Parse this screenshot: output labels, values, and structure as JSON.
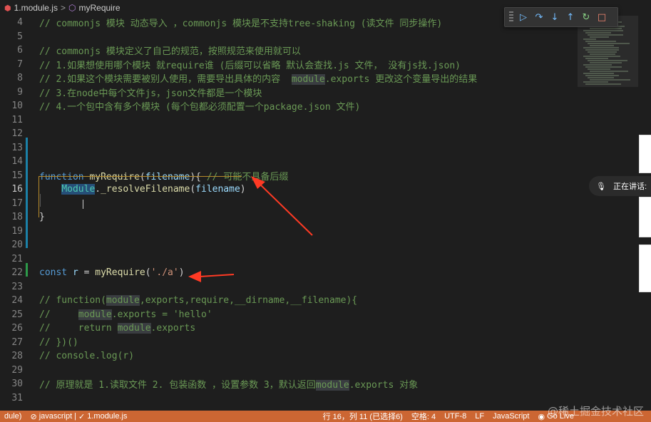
{
  "breadcrumb": {
    "file": "1.module.js",
    "separator": ">",
    "symbol": "myRequire"
  },
  "debug_toolbar": {
    "buttons": [
      {
        "name": "continue-icon",
        "glyph": "▷",
        "color": "#75beff"
      },
      {
        "name": "step-over-icon",
        "glyph": "↷",
        "color": "#75beff"
      },
      {
        "name": "step-into-icon",
        "glyph": "↓",
        "color": "#75beff"
      },
      {
        "name": "step-out-icon",
        "glyph": "↑",
        "color": "#75beff"
      },
      {
        "name": "restart-icon",
        "glyph": "↻",
        "color": "#89d185"
      },
      {
        "name": "stop-icon",
        "glyph": "□",
        "color": "#f48771"
      }
    ]
  },
  "lines": [
    {
      "n": "4",
      "tokens": [
        {
          "t": "// commonjs 模块 动态导入 ，commonjs 模块是不支持tree-shaking (读文件 同步操作)",
          "c": "comment"
        }
      ]
    },
    {
      "n": "5",
      "tokens": []
    },
    {
      "n": "6",
      "tokens": [
        {
          "t": "// commonjs 模块定义了自己的规范，按照规范来使用就可以",
          "c": "comment"
        }
      ]
    },
    {
      "n": "7",
      "tokens": [
        {
          "t": "// 1.如果想使用哪个模块 就require谁 (后缀可以省略 默认会查找.js 文件， 没有js找.json)",
          "c": "comment"
        }
      ]
    },
    {
      "n": "8",
      "tokens": [
        {
          "t": "// 2.如果这个模块需要被别人使用，需要导出具体的内容  ",
          "c": "comment"
        },
        {
          "t": "module",
          "c": "comment-hl"
        },
        {
          "t": ".exports 更改这个变量导出的结果",
          "c": "comment"
        }
      ]
    },
    {
      "n": "9",
      "tokens": [
        {
          "t": "// 3.在node中每个文件js，json文件都是一个模块",
          "c": "comment"
        }
      ]
    },
    {
      "n": "10",
      "tokens": [
        {
          "t": "// 4.一个包中含有多个模块 (每个包都必须配置一个package.json 文件)",
          "c": "comment"
        }
      ]
    },
    {
      "n": "11",
      "tokens": []
    },
    {
      "n": "12",
      "tokens": []
    },
    {
      "n": "13",
      "tokens": []
    },
    {
      "n": "14",
      "tokens": []
    },
    {
      "n": "15",
      "tokens": [
        {
          "t": "function ",
          "c": "kw"
        },
        {
          "t": "myRequire",
          "c": "fn"
        },
        {
          "t": "(",
          "c": "punc"
        },
        {
          "t": "filename",
          "c": "param"
        },
        {
          "t": "){ ",
          "c": "punc"
        },
        {
          "t": "// 可能不具备后缀",
          "c": "comment"
        }
      ]
    },
    {
      "n": "16",
      "active": true,
      "tokens": [
        {
          "t": "    ",
          "c": "punc"
        },
        {
          "t": "Module",
          "c": "type-hl"
        },
        {
          "t": ".",
          "c": "punc"
        },
        {
          "t": "_resolveFilename",
          "c": "fn"
        },
        {
          "t": "(",
          "c": "punc"
        },
        {
          "t": "filename",
          "c": "param"
        },
        {
          "t": ")",
          "c": "punc"
        }
      ]
    },
    {
      "n": "17",
      "tokens": []
    },
    {
      "n": "18",
      "tokens": [
        {
          "t": "}",
          "c": "punc"
        }
      ]
    },
    {
      "n": "19",
      "tokens": []
    },
    {
      "n": "20",
      "tokens": []
    },
    {
      "n": "21",
      "tokens": []
    },
    {
      "n": "22",
      "tokens": [
        {
          "t": "const ",
          "c": "kw"
        },
        {
          "t": "r",
          "c": "param"
        },
        {
          "t": " = ",
          "c": "punc"
        },
        {
          "t": "myRequire",
          "c": "fn"
        },
        {
          "t": "(",
          "c": "punc"
        },
        {
          "t": "'./a'",
          "c": "str"
        },
        {
          "t": ")",
          "c": "punc"
        }
      ]
    },
    {
      "n": "23",
      "tokens": []
    },
    {
      "n": "24",
      "tokens": [
        {
          "t": "// function(",
          "c": "comment"
        },
        {
          "t": "module",
          "c": "comment-hl"
        },
        {
          "t": ",exports,require,__dirname,__filename){",
          "c": "comment"
        }
      ]
    },
    {
      "n": "25",
      "tokens": [
        {
          "t": "//     ",
          "c": "comment"
        },
        {
          "t": "module",
          "c": "comment-hl"
        },
        {
          "t": ".exports = 'hello'",
          "c": "comment"
        }
      ]
    },
    {
      "n": "26",
      "tokens": [
        {
          "t": "//     return ",
          "c": "comment"
        },
        {
          "t": "module",
          "c": "comment-hl"
        },
        {
          "t": ".exports",
          "c": "comment"
        }
      ]
    },
    {
      "n": "27",
      "tokens": [
        {
          "t": "// })()",
          "c": "comment"
        }
      ]
    },
    {
      "n": "28",
      "tokens": [
        {
          "t": "// console.log(r)",
          "c": "comment"
        }
      ]
    },
    {
      "n": "29",
      "tokens": []
    },
    {
      "n": "30",
      "tokens": [
        {
          "t": "// 原理就是 1.读取文件 2. 包装函数 ，设置参数 3，默认返回",
          "c": "comment"
        },
        {
          "t": "module",
          "c": "comment-hl"
        },
        {
          "t": ".exports 对象",
          "c": "comment"
        }
      ]
    },
    {
      "n": "31",
      "tokens": []
    }
  ],
  "voice_pill": {
    "text": "正在讲话:"
  },
  "status_bar": {
    "left_fragment": "dule)",
    "language_badge": "javascript",
    "file_check": "1.module.js",
    "cursor": "行 16，列 11 (已选择6)",
    "indent": "空格: 4",
    "encoding": "UTF-8",
    "eol": "LF",
    "language": "JavaScript",
    "golive": "Go Live",
    "background": "#cc6633"
  },
  "watermark": "@稀土掘金技术社区"
}
